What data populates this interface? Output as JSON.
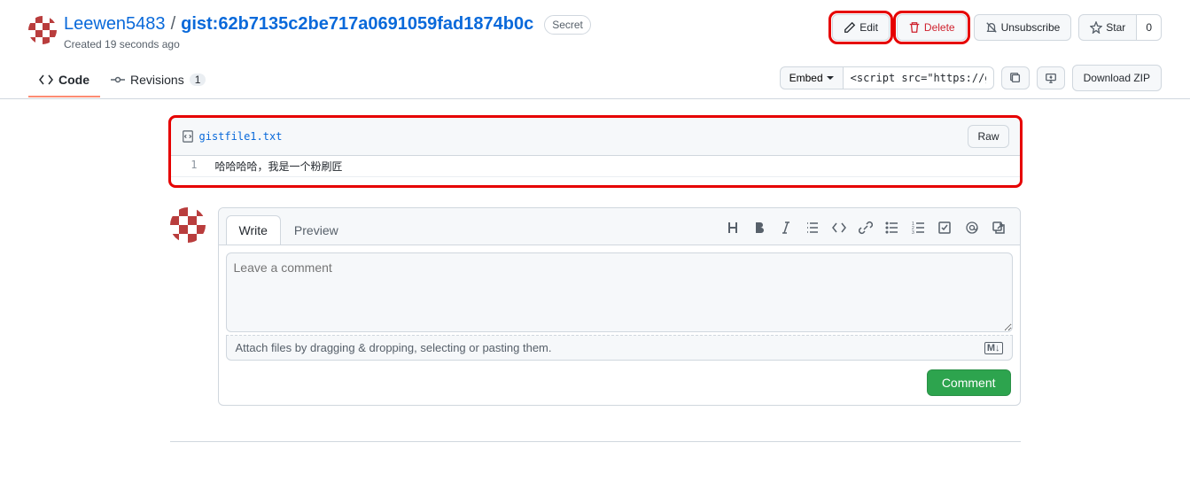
{
  "header": {
    "username": "Leewen5483",
    "separator": "/",
    "gist_name": "gist:62b7135c2be717a0691059fad1874b0c",
    "secret_label": "Secret",
    "created_text": "Created 19 seconds ago"
  },
  "actions": {
    "edit": "Edit",
    "delete": "Delete",
    "unsubscribe": "Unsubscribe",
    "star": "Star",
    "star_count": "0"
  },
  "tabs": {
    "code": "Code",
    "revisions": "Revisions",
    "revisions_count": "1"
  },
  "embed": {
    "embed_label": "Embed",
    "script_value": "<script src=\"https://gis",
    "download_label": "Download ZIP"
  },
  "file": {
    "name": "gistfile1.txt",
    "raw_label": "Raw",
    "line_number": "1",
    "line_content": "哈哈哈哈，我是一个粉刷匠"
  },
  "comment": {
    "write_tab": "Write",
    "preview_tab": "Preview",
    "placeholder": "Leave a comment",
    "attach_hint": "Attach files by dragging & dropping, selecting or pasting them.",
    "markdown_badge": "M↓",
    "submit": "Comment"
  },
  "icons": {
    "code": "code-icon",
    "revisions": "git-commit-icon",
    "pencil": "pencil-icon",
    "trash": "trash-icon",
    "bell_off": "bell-slash-icon",
    "star": "star-icon",
    "copy": "copy-icon",
    "desktop": "desktop-download-icon",
    "file_code": "file-code-icon",
    "caret": "caret-down"
  }
}
